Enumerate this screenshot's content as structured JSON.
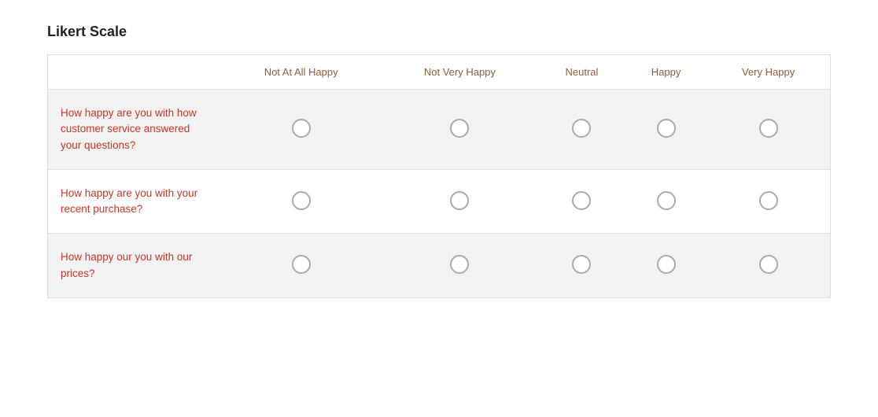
{
  "title": "Likert Scale",
  "columns": [
    {
      "key": "question",
      "label": ""
    },
    {
      "key": "col1",
      "label": "Not At All Happy"
    },
    {
      "key": "col2",
      "label": "Not Very Happy"
    },
    {
      "key": "col3",
      "label": "Neutral"
    },
    {
      "key": "col4",
      "label": "Happy"
    },
    {
      "key": "col5",
      "label": "Very Happy"
    }
  ],
  "rows": [
    {
      "question": "How happy are you with how customer service answered your questions?",
      "selected": null
    },
    {
      "question": "How happy are you with your recent purchase?",
      "selected": null
    },
    {
      "question": "How happy our you with our prices?",
      "selected": null
    }
  ]
}
